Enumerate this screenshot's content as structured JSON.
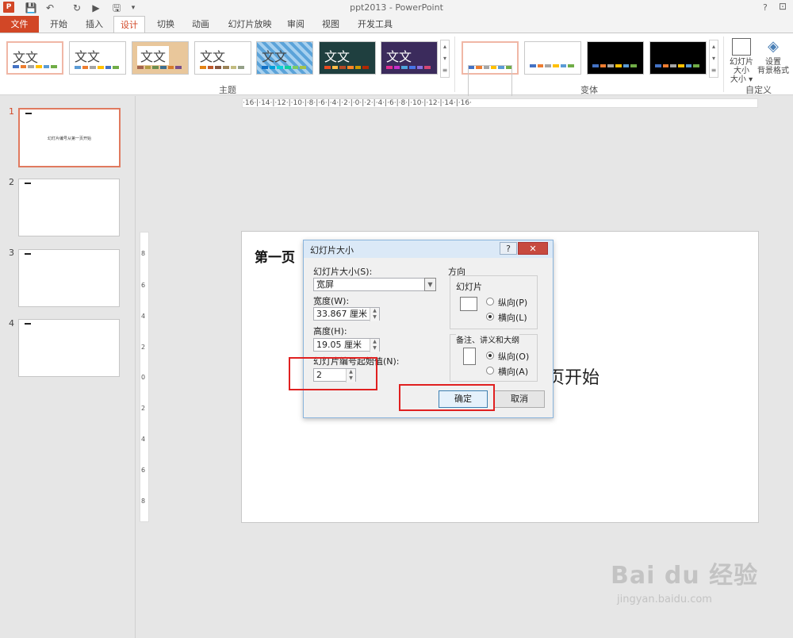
{
  "window": {
    "title": "ppt2013 - PowerPoint",
    "help": "?"
  },
  "tabs": [
    "文件",
    "开始",
    "插入",
    "设计",
    "切换",
    "动画",
    "幻灯片放映",
    "审阅",
    "视图",
    "开发工具"
  ],
  "ribbon": {
    "theme_label": "文文",
    "groups": {
      "themes": "主题",
      "variants": "变体",
      "customize": "自定义"
    },
    "slide_size_btn": "幻灯片大小",
    "slide_size_btn2": "大小 ▾",
    "bg_btn": "设置",
    "bg_btn2": "背景格式"
  },
  "slides": {
    "numbers": [
      "1",
      "2",
      "3",
      "4"
    ],
    "thumb1_text": "幻灯片编号从第一页开始"
  },
  "ruler": {
    "h": "·16·|·14·|·12·|·10·|·8·|·6·|·4·|·2·|·0·|·2·|·4·|·6·|·8·|·10·|·12·|·14·|·16·",
    "v": [
      "8",
      "6",
      "4",
      "2",
      "0",
      "2",
      "4",
      "6",
      "8"
    ]
  },
  "slide": {
    "title": "第一页",
    "body": "页开始"
  },
  "dialog": {
    "title": "幻灯片大小",
    "size_label": "幻灯片大小(S):",
    "size_value": "宽屏",
    "width_label": "宽度(W):",
    "width_value": "33.867 厘米",
    "height_label": "高度(H):",
    "height_value": "19.05 厘米",
    "start_label": "幻灯片编号起始值(N):",
    "start_value": "2",
    "orientation_label": "方向",
    "slides_label": "幻灯片",
    "portrait": "纵向(P)",
    "landscape": "横向(L)",
    "notes_label": "备注、讲义和大纲",
    "notes_portrait": "纵向(O)",
    "notes_landscape": "横向(A)",
    "ok": "确定",
    "cancel": "取消"
  },
  "watermark": {
    "brand": "Bai du 经验",
    "url": "jingyan.baidu.com"
  }
}
